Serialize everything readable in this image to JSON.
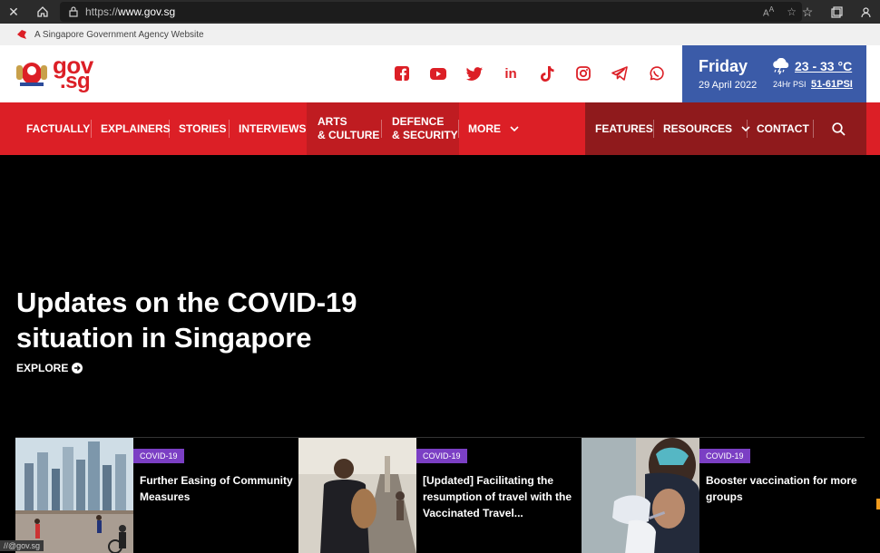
{
  "browser": {
    "url_prefix": "https://",
    "url_domain": "www.gov.sg"
  },
  "agency_strip": {
    "text": "A Singapore Government Agency Website"
  },
  "logo": {
    "line1": "gov",
    "line2": ".sg"
  },
  "weather": {
    "day": "Friday",
    "date": "29 April 2022",
    "temp": "23 - 33 °C",
    "psi_label": "24Hr PSI",
    "psi_value": "51-61PSI"
  },
  "nav": {
    "factually": "FACTUALLY",
    "explainers": "EXPLAINERS",
    "stories": "STORIES",
    "interviews": "INTERVIEWS",
    "arts_line1": "ARTS",
    "arts_line2": "& CULTURE",
    "defence_line1": "DEFENCE",
    "defence_line2": "& SECURITY",
    "more": "MORE",
    "features": "FEATURES",
    "resources": "RESOURCES",
    "contact": "CONTACT"
  },
  "hero": {
    "title": "Updates on the COVID-19 situation in Singapore",
    "explore": "EXPLORE"
  },
  "cards": [
    {
      "tag": "COVID-19",
      "title": "Further Easing of Community Measures"
    },
    {
      "tag": "COVID-19",
      "title": "[Updated] Facilitating the resumption of travel with the Vaccinated Travel..."
    },
    {
      "tag": "COVID-19",
      "title": "Booster vaccination for more groups"
    }
  ],
  "status_bar": {
    "text": "//@gov.sg"
  },
  "colors": {
    "brand_red": "#dc1f26",
    "weather_blue": "#3b5ba8",
    "tag_purple": "#7b3fc4"
  }
}
